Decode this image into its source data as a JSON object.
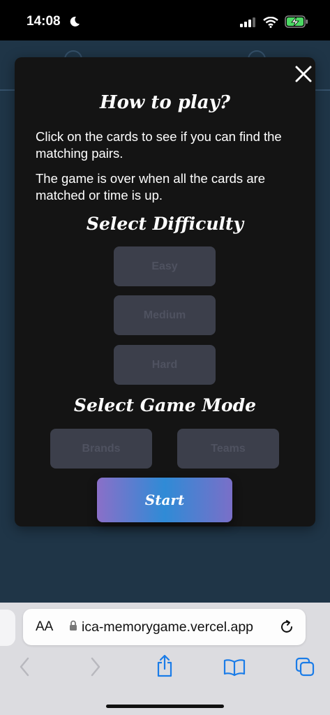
{
  "status_bar": {
    "time": "14:08"
  },
  "modal": {
    "title": "How to play?",
    "instructions": [
      "Click on the cards to see if you can find the matching pairs.",
      "The game is over when all the cards are matched or time is up."
    ],
    "difficulty_title": "Select Difficulty",
    "difficulties": [
      "Easy",
      "Medium",
      "Hard"
    ],
    "mode_title": "Select Game Mode",
    "modes": [
      "Brands",
      "Teams"
    ],
    "start_label": "Start"
  },
  "browser": {
    "text_size_label": "AA",
    "url": "ica-memorygame.vercel.app"
  },
  "icons": [
    "moon-icon",
    "signal-icon",
    "wifi-icon",
    "battery-charging-icon",
    "close-icon",
    "lock-icon",
    "reload-icon",
    "back-icon",
    "forward-icon",
    "share-icon",
    "bookmarks-icon",
    "tabs-icon"
  ]
}
